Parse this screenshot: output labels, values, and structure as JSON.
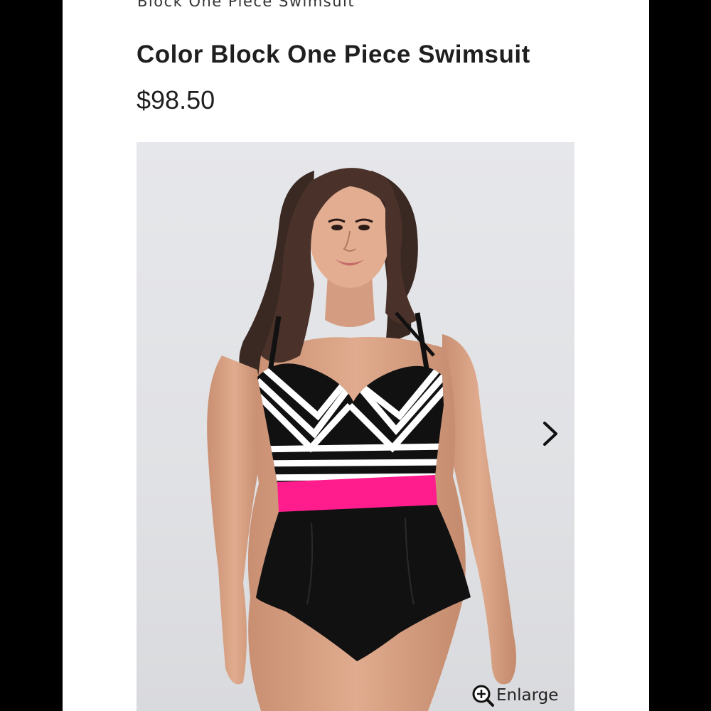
{
  "breadcrumb": "Block One Piece Swimsuit",
  "product": {
    "title": "Color Block One Piece Swimsuit",
    "price": "$98.50"
  },
  "gallery": {
    "next_icon": "chevron-right-icon",
    "enlarge_icon": "zoom-in-icon",
    "enlarge_label": "Enlarge"
  },
  "colors": {
    "accent_pink": "#ff1d8e",
    "swimsuit_black": "#111111",
    "background": "#ffffff"
  }
}
